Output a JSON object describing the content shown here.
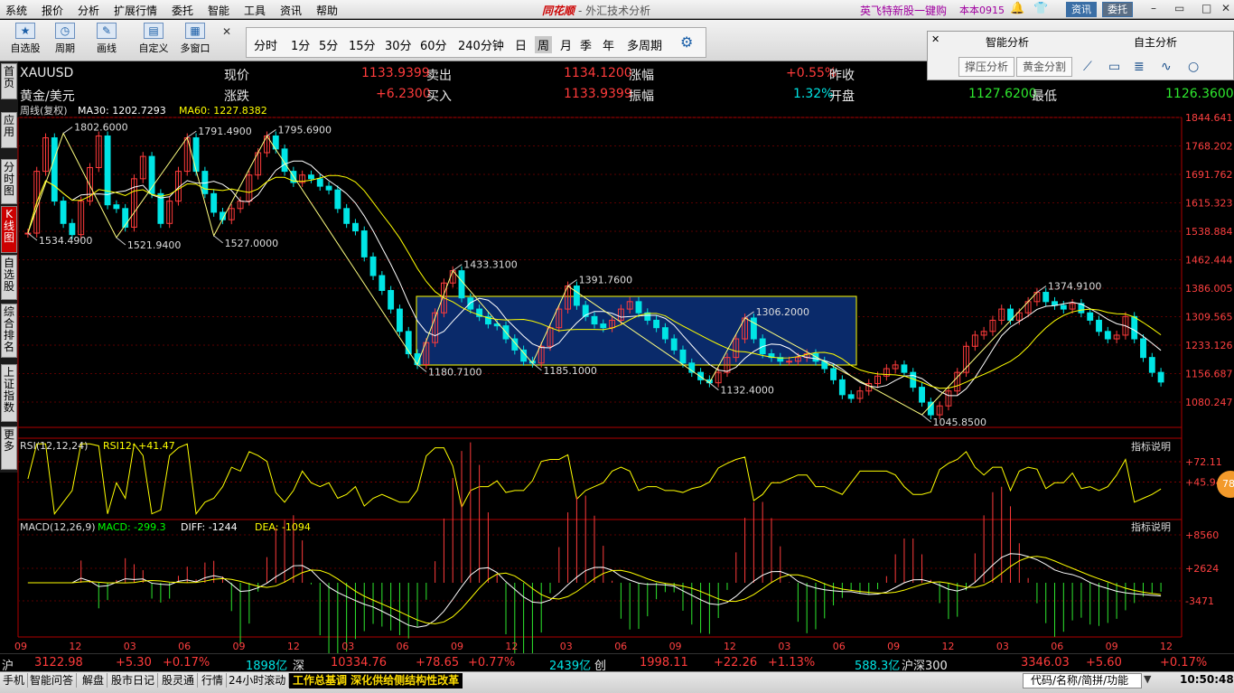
{
  "menu": {
    "items": [
      "系统",
      "报价",
      "分析",
      "扩展行情",
      "委托",
      "智能",
      "工具",
      "资讯",
      "帮助"
    ],
    "brand": "同花顺",
    "app_title": "外汇技术分析",
    "promo": "英飞特新股一键购",
    "version": "本本0915",
    "btn_news": "资讯",
    "btn_trade": "委托"
  },
  "toolbar": {
    "buttons": [
      "自选股",
      "周期",
      "画线",
      "自定义",
      "多窗口"
    ],
    "periods": [
      "分时",
      "1分",
      "5分",
      "15分",
      "30分",
      "60分",
      "240分钟",
      "日",
      "周",
      "月",
      "季",
      "年",
      "多周期"
    ],
    "active_period": "周"
  },
  "smart_panel": {
    "tab_smart": "智能分析",
    "tab_self": "自主分析",
    "btn_pressure": "撑压分析",
    "btn_golden": "黄金分割"
  },
  "sidetabs": [
    "首页",
    "应用",
    "分时图",
    "K线图",
    "自选股",
    "综合排名",
    "上证指数",
    "更多"
  ],
  "quote": {
    "symbol": "XAUUSD",
    "name": "黄金/美元",
    "l_now": "现价",
    "v_now": "1133.9399",
    "l_sell": "卖出",
    "v_sell": "1134.1200",
    "l_pct": "涨幅",
    "v_pct": "+0.55%",
    "l_prev": "昨收",
    "l_chg": "涨跌",
    "v_chg": "+6.2300",
    "l_buy": "买入",
    "v_buy": "1133.9399",
    "l_amp": "振幅",
    "v_amp": "1.32%",
    "l_open": "开盘",
    "v_open": "1127.6200",
    "l_low": "最低",
    "v_low": "1126.3600"
  },
  "indicators": {
    "ma_title": "周线(复权)",
    "ma30": "MA30: 1202.7293",
    "ma60": "MA60: 1227.8382",
    "rsi_title": "RSI(12,12,24)",
    "rsi12": "RSI12: +41.47",
    "macd_title": "MACD(12,26,9)",
    "macd": "MACD: -299.3",
    "diff": "DIFF: -1244",
    "dea": "DEA: -1094",
    "explain": "指标说明"
  },
  "colors": {
    "up": "#ff3b3b",
    "down": "#00e5e5",
    "ma30": "#ffffff",
    "ma60": "#ffff00",
    "axis": "#b00000"
  },
  "chart_data": {
    "type": "candlestick",
    "title": "XAUUSD 周线",
    "price_axis": [
      "1844.641",
      "1768.202",
      "1691.762",
      "1615.323",
      "1538.884",
      "1462.444",
      "1386.005",
      "1309.565",
      "1233.126",
      "1156.687",
      "1080.247"
    ],
    "time_axis": [
      "09",
      "12",
      "03",
      "06",
      "09",
      "12",
      "03",
      "06",
      "09",
      "12",
      "03",
      "06",
      "09",
      "12",
      "03",
      "06",
      "09",
      "12",
      "03",
      "06",
      "09",
      "12"
    ],
    "close": [
      1534,
      1700,
      1790,
      1620,
      1560,
      1530,
      1620,
      1710,
      1795,
      1610,
      1600,
      1550,
      1680,
      1740,
      1640,
      1560,
      1620,
      1700,
      1790,
      1700,
      1640,
      1590,
      1570,
      1600,
      1620,
      1690,
      1750,
      1795,
      1760,
      1700,
      1670,
      1690,
      1680,
      1660,
      1650,
      1600,
      1560,
      1540,
      1470,
      1420,
      1380,
      1330,
      1270,
      1210,
      1181,
      1240,
      1320,
      1400,
      1433,
      1360,
      1330,
      1310,
      1290,
      1285,
      1250,
      1220,
      1190,
      1185,
      1230,
      1280,
      1330,
      1392,
      1340,
      1310,
      1290,
      1280,
      1300,
      1330,
      1350,
      1320,
      1300,
      1280,
      1250,
      1220,
      1185,
      1160,
      1140,
      1132,
      1160,
      1200,
      1250,
      1306,
      1250,
      1210,
      1200,
      1190,
      1190,
      1200,
      1210,
      1190,
      1170,
      1140,
      1100,
      1090,
      1110,
      1130,
      1150,
      1170,
      1180,
      1160,
      1120,
      1080,
      1046,
      1070,
      1110,
      1160,
      1230,
      1260,
      1270,
      1300,
      1330,
      1300,
      1320,
      1350,
      1375,
      1350,
      1340,
      1330,
      1345,
      1320,
      1300,
      1270,
      1250,
      1260,
      1310,
      1250,
      1200,
      1160,
      1134
    ],
    "annotations": [
      {
        "label": "1802.6000",
        "type": "high"
      },
      {
        "label": "1791.4900",
        "type": "high"
      },
      {
        "label": "1795.6900",
        "type": "high"
      },
      {
        "label": "1534.4900",
        "type": "low"
      },
      {
        "label": "1521.9400",
        "type": "low"
      },
      {
        "label": "1527.0000",
        "type": "low"
      },
      {
        "label": "1433.3100",
        "type": "high"
      },
      {
        "label": "1391.7600",
        "type": "high"
      },
      {
        "label": "1306.2000",
        "type": "high"
      },
      {
        "label": "1374.9100",
        "type": "high"
      },
      {
        "label": "1180.7100",
        "type": "low"
      },
      {
        "label": "1185.1000",
        "type": "low"
      },
      {
        "label": "1132.4000",
        "type": "low"
      },
      {
        "label": "1045.8500",
        "type": "low"
      }
    ],
    "rsi_axis": [
      "+72.11",
      "+45.94"
    ],
    "macd_axis": [
      "+8560",
      "+2624",
      "-3471"
    ]
  },
  "status": {
    "sh": "沪",
    "sh_val": "3122.98",
    "sh_chg": "+5.30",
    "sh_pct": "+0.17%",
    "sh_amt": "1898亿",
    "sz": "深",
    "sz_val": "10334.76",
    "sz_chg": "+78.65",
    "sz_pct": "+0.77%",
    "sz_amt": "2439亿",
    "cy": "创",
    "cy_val": "1998.11",
    "cy_chg": "+22.26",
    "cy_pct": "+1.13%",
    "hs_amt": "588.3亿",
    "hs": "沪深300",
    "hs_val": "3346.03",
    "hs_chg": "+5.60",
    "hs_pct": "+0.17%"
  },
  "bottom": {
    "tabs": [
      "手机",
      "智能问答",
      "解盘",
      "股市日记",
      "股灵通",
      "行情",
      "24小时滚动"
    ],
    "news": "工作总基调 深化供给侧结构性改革",
    "search_placeholder": "代码/名称/简拼/功能",
    "clock": "10:50:48",
    "badge": "78"
  }
}
